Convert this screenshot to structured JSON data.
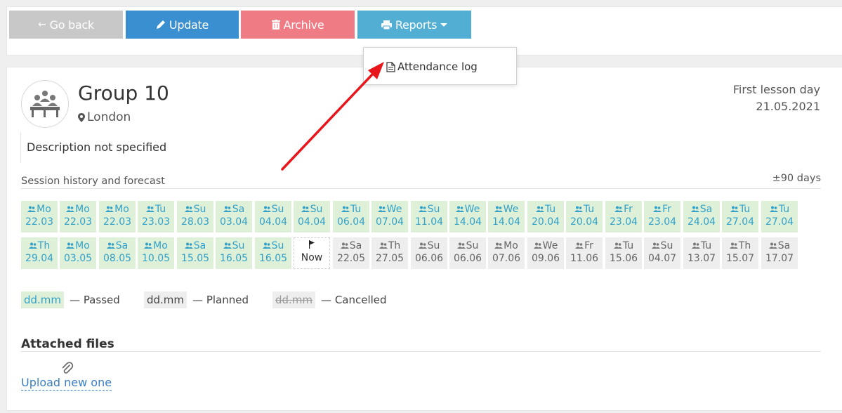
{
  "toolbar": {
    "back_label": "Go back",
    "update_label": "Update",
    "archive_label": "Archive",
    "reports_label": "Reports",
    "back_color": "#c8c8c8",
    "update_color": "#3a8fd0",
    "archive_color": "#ef7b85",
    "reports_color": "#52aed2"
  },
  "reports_menu": {
    "items": [
      {
        "label": "Attendance log",
        "icon": "document-icon"
      }
    ]
  },
  "group": {
    "name": "Group 10",
    "location": "London",
    "description": "Description not specified",
    "first_lesson_label": "First lesson day",
    "first_lesson_date": "21.05.2021"
  },
  "sessions": {
    "title": "Session history and forecast",
    "range": "±90 days",
    "items": [
      {
        "day": "Mo",
        "date": "22.03",
        "status": "passed"
      },
      {
        "day": "Mo",
        "date": "22.03",
        "status": "passed"
      },
      {
        "day": "Mo",
        "date": "22.03",
        "status": "passed"
      },
      {
        "day": "Tu",
        "date": "23.03",
        "status": "passed"
      },
      {
        "day": "Su",
        "date": "28.03",
        "status": "passed"
      },
      {
        "day": "Sa",
        "date": "03.04",
        "status": "passed"
      },
      {
        "day": "Su",
        "date": "04.04",
        "status": "passed"
      },
      {
        "day": "Su",
        "date": "04.04",
        "status": "passed"
      },
      {
        "day": "Tu",
        "date": "06.04",
        "status": "passed"
      },
      {
        "day": "We",
        "date": "07.04",
        "status": "passed"
      },
      {
        "day": "Su",
        "date": "11.04",
        "status": "passed"
      },
      {
        "day": "We",
        "date": "14.04",
        "status": "passed"
      },
      {
        "day": "We",
        "date": "14.04",
        "status": "passed"
      },
      {
        "day": "Tu",
        "date": "20.04",
        "status": "passed"
      },
      {
        "day": "Tu",
        "date": "20.04",
        "status": "passed"
      },
      {
        "day": "Fr",
        "date": "23.04",
        "status": "passed"
      },
      {
        "day": "Fr",
        "date": "23.04",
        "status": "passed"
      },
      {
        "day": "Sa",
        "date": "24.04",
        "status": "passed"
      },
      {
        "day": "Tu",
        "date": "27.04",
        "status": "passed"
      },
      {
        "day": "Tu",
        "date": "27.04",
        "status": "passed"
      },
      {
        "day": "Th",
        "date": "29.04",
        "status": "passed"
      },
      {
        "day": "Mo",
        "date": "03.05",
        "status": "passed"
      },
      {
        "day": "Sa",
        "date": "08.05",
        "status": "passed"
      },
      {
        "day": "Mo",
        "date": "10.05",
        "status": "passed"
      },
      {
        "day": "Sa",
        "date": "15.05",
        "status": "passed"
      },
      {
        "day": "Su",
        "date": "16.05",
        "status": "passed"
      },
      {
        "day": "Su",
        "date": "16.05",
        "status": "passed"
      },
      {
        "day": "",
        "date": "Now",
        "status": "now"
      },
      {
        "day": "Sa",
        "date": "22.05",
        "status": "planned"
      },
      {
        "day": "Th",
        "date": "27.05",
        "status": "planned"
      },
      {
        "day": "Su",
        "date": "06.06",
        "status": "planned"
      },
      {
        "day": "Su",
        "date": "06.06",
        "status": "planned"
      },
      {
        "day": "Mo",
        "date": "07.06",
        "status": "planned"
      },
      {
        "day": "We",
        "date": "09.06",
        "status": "planned"
      },
      {
        "day": "Fr",
        "date": "11.06",
        "status": "planned"
      },
      {
        "day": "Tu",
        "date": "15.06",
        "status": "planned"
      },
      {
        "day": "Su",
        "date": "04.07",
        "status": "planned"
      },
      {
        "day": "Tu",
        "date": "13.07",
        "status": "planned"
      },
      {
        "day": "Th",
        "date": "15.07",
        "status": "planned"
      },
      {
        "day": "Sa",
        "date": "17.07",
        "status": "planned"
      }
    ],
    "colors": {
      "passed_bg": "#dff0d8",
      "passed_text": "#31a0c9",
      "planned_bg": "#eeeeee",
      "planned_text": "#666666"
    }
  },
  "legend": {
    "sample": "dd.mm",
    "passed": "— Passed",
    "planned": "— Planned",
    "cancelled": "— Cancelled"
  },
  "files": {
    "title": "Attached files",
    "upload_label": "Upload new one"
  }
}
